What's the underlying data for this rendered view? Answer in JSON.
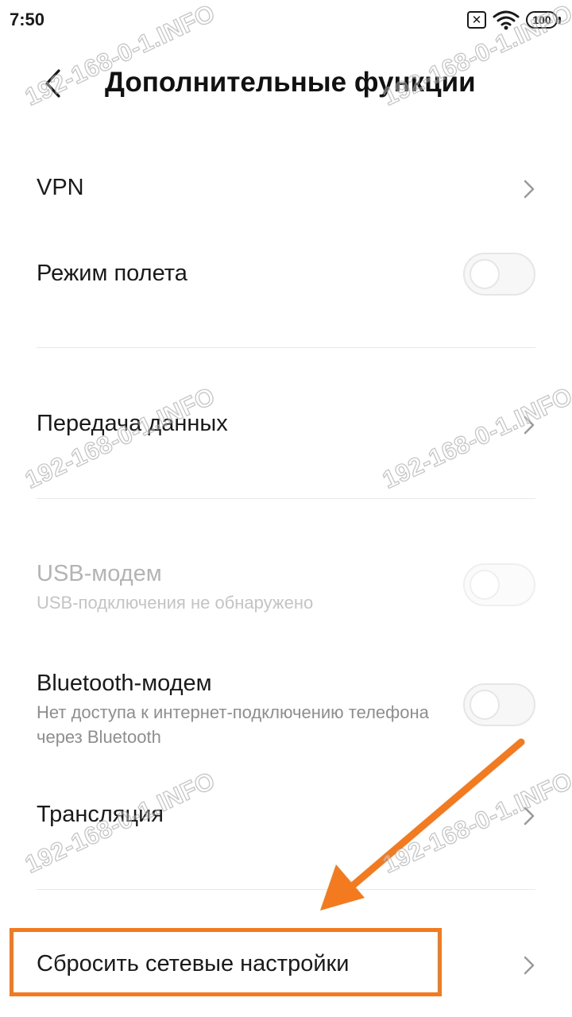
{
  "status_bar": {
    "time": "7:50",
    "sim_glyph": "✕",
    "battery": "100"
  },
  "header": {
    "title": "Дополнительные функции"
  },
  "items": [
    {
      "title": "VPN",
      "control": "chevron"
    },
    {
      "title": "Режим полета",
      "control": "toggle",
      "on": false
    },
    {
      "title": "Передача данных",
      "control": "chevron"
    },
    {
      "title": "USB-модем",
      "subtitle": "USB-подключения не обнаружено",
      "control": "toggle",
      "on": false,
      "enabled": false
    },
    {
      "title": "Bluetooth-модем",
      "subtitle": "Нет доступа к интернет-подключению телефона через Bluetooth",
      "control": "toggle",
      "on": false
    },
    {
      "title": "Трансляция",
      "control": "chevron"
    },
    {
      "title": "Сбросить сетевые настройки",
      "control": "chevron"
    }
  ],
  "annotation": {
    "color": "#f47a20"
  },
  "watermark": {
    "text": "192-168-0-1.INFO"
  },
  "colors": {
    "background": "#ffffff",
    "text": "#1a1a1a",
    "secondary_text": "#8e8e8e",
    "annotation": "#f47a20"
  }
}
